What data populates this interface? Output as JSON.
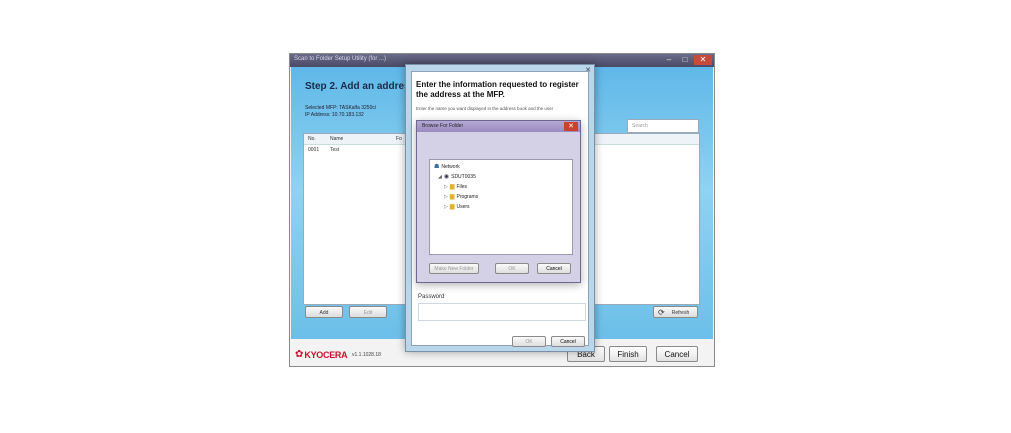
{
  "wizard": {
    "title": "Scan to Folder Setup Utility (for ...)",
    "step_title": "Step 2. Add an address to",
    "selected_mfp": "Selected MFP: TASKalfa 3250ci",
    "ip_address": "IP Address: 10.70.183.132",
    "search_placeholder": "Search",
    "table": {
      "columns": [
        "No.",
        "Name",
        "Fo"
      ],
      "rows": [
        [
          "0001",
          "Test"
        ]
      ]
    },
    "buttons": {
      "add": "Add",
      "edit": "Edit",
      "refresh": "Refresh"
    },
    "footer": {
      "logo": "KYOCERA",
      "version": "v1.1.1028.18",
      "back": "Back",
      "finish": "Finish",
      "cancel": "Cancel"
    }
  },
  "register_dialog": {
    "heading": "Enter the information requested to register the address at the MFP.",
    "description": "Enter the name you want displayed in the address book and the user",
    "password_label": "Password",
    "ok": "OK",
    "cancel": "Cancel"
  },
  "browse_folder": {
    "title": "Browse For Folder",
    "tree": {
      "network": "Network",
      "computer": "SDUT0035",
      "folders": [
        "Files",
        "Programs",
        "Users"
      ]
    },
    "make_new_folder": "Make New Folder",
    "ok": "OK",
    "cancel": "Cancel"
  },
  "icons": [
    "close-icon",
    "minimize-icon",
    "maximize-icon",
    "refresh-icon",
    "network-icon",
    "computer-icon",
    "folder-icon",
    "kyocera-logo-icon"
  ],
  "colors": {
    "wizard_body_gradient_top": "#5fb8e8",
    "wizard_body_gradient_mid": "#8fd2f2",
    "titlebar": "#5a5a78",
    "close_button": "#c84a3a",
    "kyocera_red": "#c8102e"
  }
}
